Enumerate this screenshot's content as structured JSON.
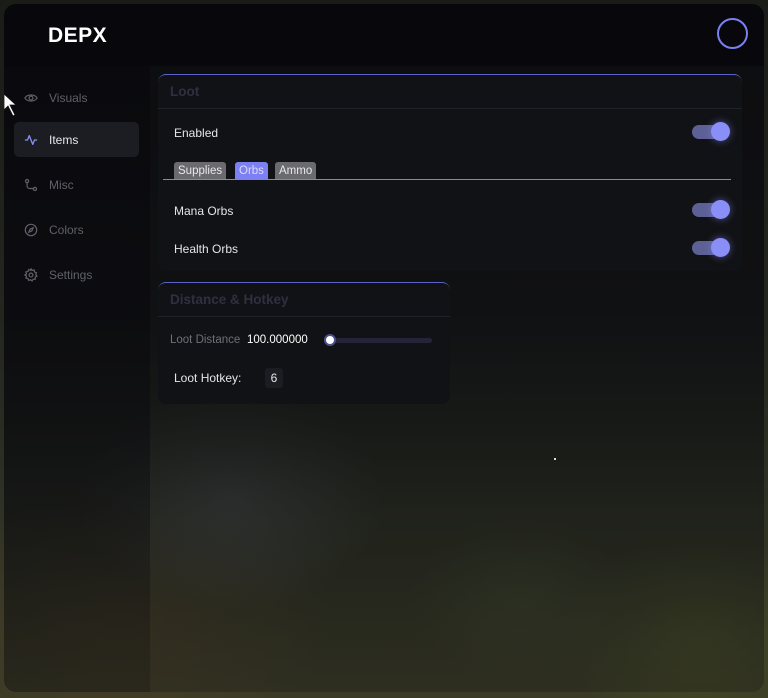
{
  "app": {
    "logo": "DEPX"
  },
  "sidebar": {
    "items": [
      {
        "label": "Visuals",
        "icon": "eye-icon",
        "active": false
      },
      {
        "label": "Items",
        "icon": "activity-icon",
        "active": true
      },
      {
        "label": "Misc",
        "icon": "route-icon",
        "active": false
      },
      {
        "label": "Colors",
        "icon": "compass-icon",
        "active": false
      },
      {
        "label": "Settings",
        "icon": "gear-icon",
        "active": false
      }
    ]
  },
  "loot_panel": {
    "title": "Loot",
    "enabled_label": "Enabled",
    "enabled": true,
    "tabs": [
      {
        "label": "Supplies",
        "active": false
      },
      {
        "label": "Orbs",
        "active": true
      },
      {
        "label": "Ammo",
        "active": false
      }
    ],
    "options": [
      {
        "label": "Mana Orbs",
        "enabled": true
      },
      {
        "label": "Health Orbs",
        "enabled": true
      }
    ]
  },
  "distance_panel": {
    "title": "Distance & Hotkey",
    "loot_distance_label": "Loot Distance",
    "loot_distance_value": "100.000000",
    "loot_hotkey_label": "Loot Hotkey:",
    "loot_hotkey_value": "6"
  },
  "colors": {
    "accent": "#7c80f2",
    "toggle_track": "#5d6094",
    "panel_bg": "#111216"
  }
}
